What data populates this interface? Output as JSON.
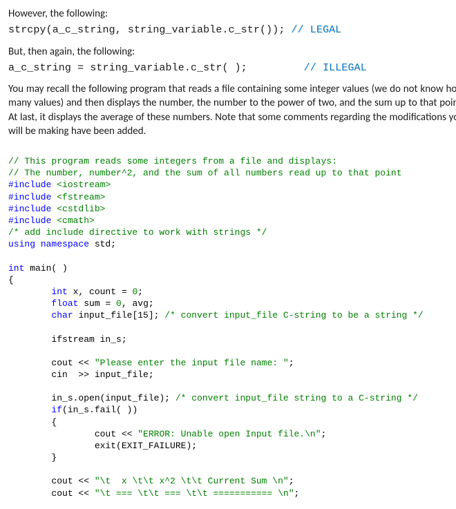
{
  "p1": "However, the following:",
  "code1": {
    "code": "strcpy(a_c_string, string_variable.c_str()); ",
    "comment": "// LEGAL"
  },
  "p2": "But, then again, the following:",
  "code2": {
    "lhs": "a_c_string = string_variable.c_str( );",
    "gap": "         ",
    "comment": "// ILLEGAL"
  },
  "p3": "You may recall the following program that reads a file containing some integer values (we do not know how many values) and then displays the number, the number to the power of two, and the sum up to that point. At last, it displays the average of these numbers. Note that some comments regarding the modifications you will be making have been added.",
  "src": {
    "c1": "// This program reads some integers from a file and displays:",
    "c2": "// The number, number^2, and the sum of all numbers read up to that point",
    "inc": "#include",
    "h1": " <iostream>",
    "h2": " <fstream>",
    "h3": " <cstdlib>",
    "h4": " <cmath>",
    "c3": "/* add include directive to work with strings */",
    "using_kw": "using",
    "namespace_kw": " namespace",
    "std_txt": " std;",
    "int_kw": "int",
    "main_decl": " main( )",
    "lbrace": "{",
    "indent1": "        ",
    "x_decl": " x, count = ",
    "zero": "0",
    "semi": ";",
    "float_kw": "float",
    "sum_decl1": " sum = ",
    "sum_decl2": ", avg;",
    "char_kw": "char",
    "input_decl": " input_file[15]; ",
    "input_cmt": "/* convert input_file C-string to be a string */",
    "ifstream_line": "ifstream in_s;",
    "cout1a": "cout << ",
    "cout1b": "\"Please enter the input file name: \"",
    "cin_line": "cin  >> input_file;",
    "open1": "in_s.open(input_file); ",
    "open_cmt": "/* convert input_file string to a C-string */",
    "if_kw": "if",
    "if_cond": "(in_s.fail( ))",
    "lbrace2": "        {",
    "indent2": "                ",
    "err1a": "cout << ",
    "err1b": "\"ERROR: Unable open Input file.\\n\"",
    "exit_line": "exit(EXIT_FAILURE);",
    "rbrace2": "        }",
    "hdr1a": "cout << ",
    "hdr1b": "\"\\t  x \\t\\t x^2 \\t\\t Current Sum \\n\"",
    "hdr2a": "cout << ",
    "hdr2b": "\"\\t === \\t\\t === \\t\\t =========== \\n\""
  }
}
